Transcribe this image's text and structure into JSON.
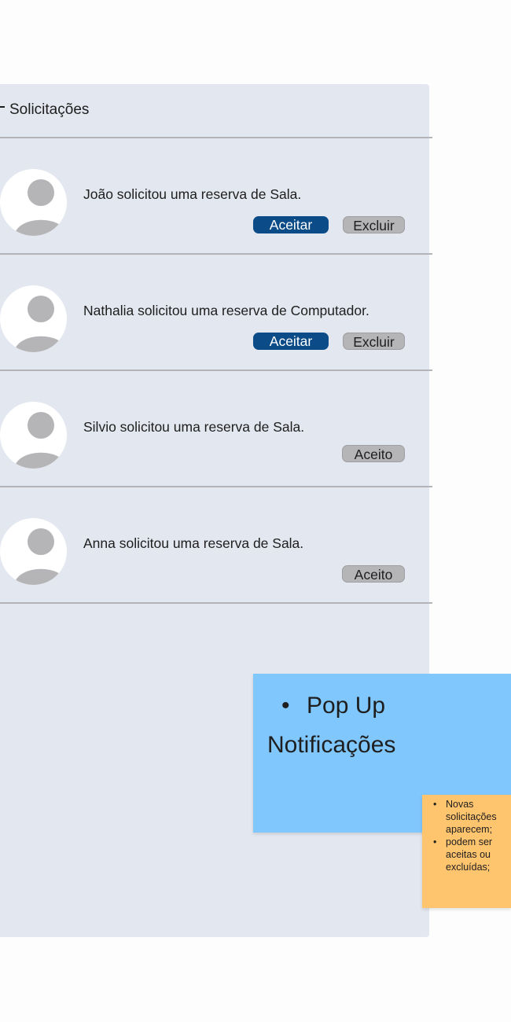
{
  "panel": {
    "title": "Solicitações"
  },
  "requests": [
    {
      "message": "João solicitou uma reserva de Sala.",
      "accept_label": "Aceitar",
      "delete_label": "Excluir"
    },
    {
      "message": "Nathalia solicitou uma reserva de Computador.",
      "accept_label": "Aceitar",
      "delete_label": "Excluir"
    },
    {
      "message": "Silvio solicitou uma reserva de Sala.",
      "status_label": "Aceito"
    },
    {
      "message": "Anna solicitou uma reserva de Sala.",
      "status_label": "Aceito"
    }
  ],
  "sticky_note": {
    "bullet": "•",
    "line1": "Pop Up",
    "line2": "Notificações"
  },
  "side_note": {
    "items": [
      "Novas solicitações aparecem;",
      "podem ser aceitas ou excluídas;"
    ]
  },
  "colors": {
    "panel_bg": "#e3e7ef",
    "accept_button": "#0b4b87",
    "neutral_button": "#b5b5b8",
    "sticky_blue": "#80c7fd",
    "sticky_orange": "#ffc46e"
  },
  "icons": {
    "avatar": "user-avatar-icon"
  }
}
